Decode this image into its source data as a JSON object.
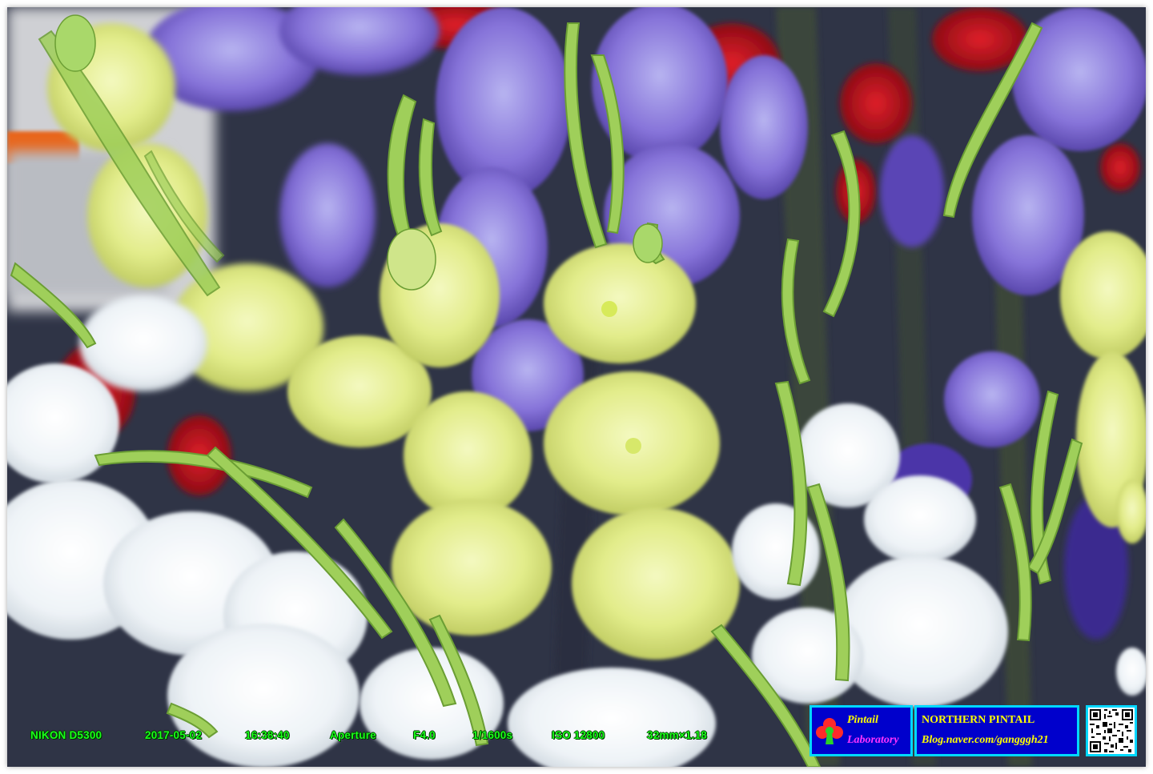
{
  "exif": {
    "camera": "NIKON D5300",
    "date": "2017-05-02",
    "time": "16:38:40",
    "mode": "Aperture",
    "fnumber": "F4.0",
    "shutter": "1/1600s",
    "iso": "ISO 12800",
    "focal": "32mm×1.18"
  },
  "badge": {
    "lab_line1": "Pintail",
    "lab_line2": "Laboratory",
    "title": "NORTHERN PINTAIL",
    "blog": "Blog.naver.com/gangggh21"
  },
  "colors": {
    "exif_text": "#1aff1a",
    "badge_bg": "#0000cc",
    "badge_border": "#00d8ff",
    "badge_yellow": "#ffff00",
    "badge_magenta": "#ff33ff"
  },
  "icons": {
    "lab_logo": "club-icon",
    "qr": "qr-code-icon"
  }
}
